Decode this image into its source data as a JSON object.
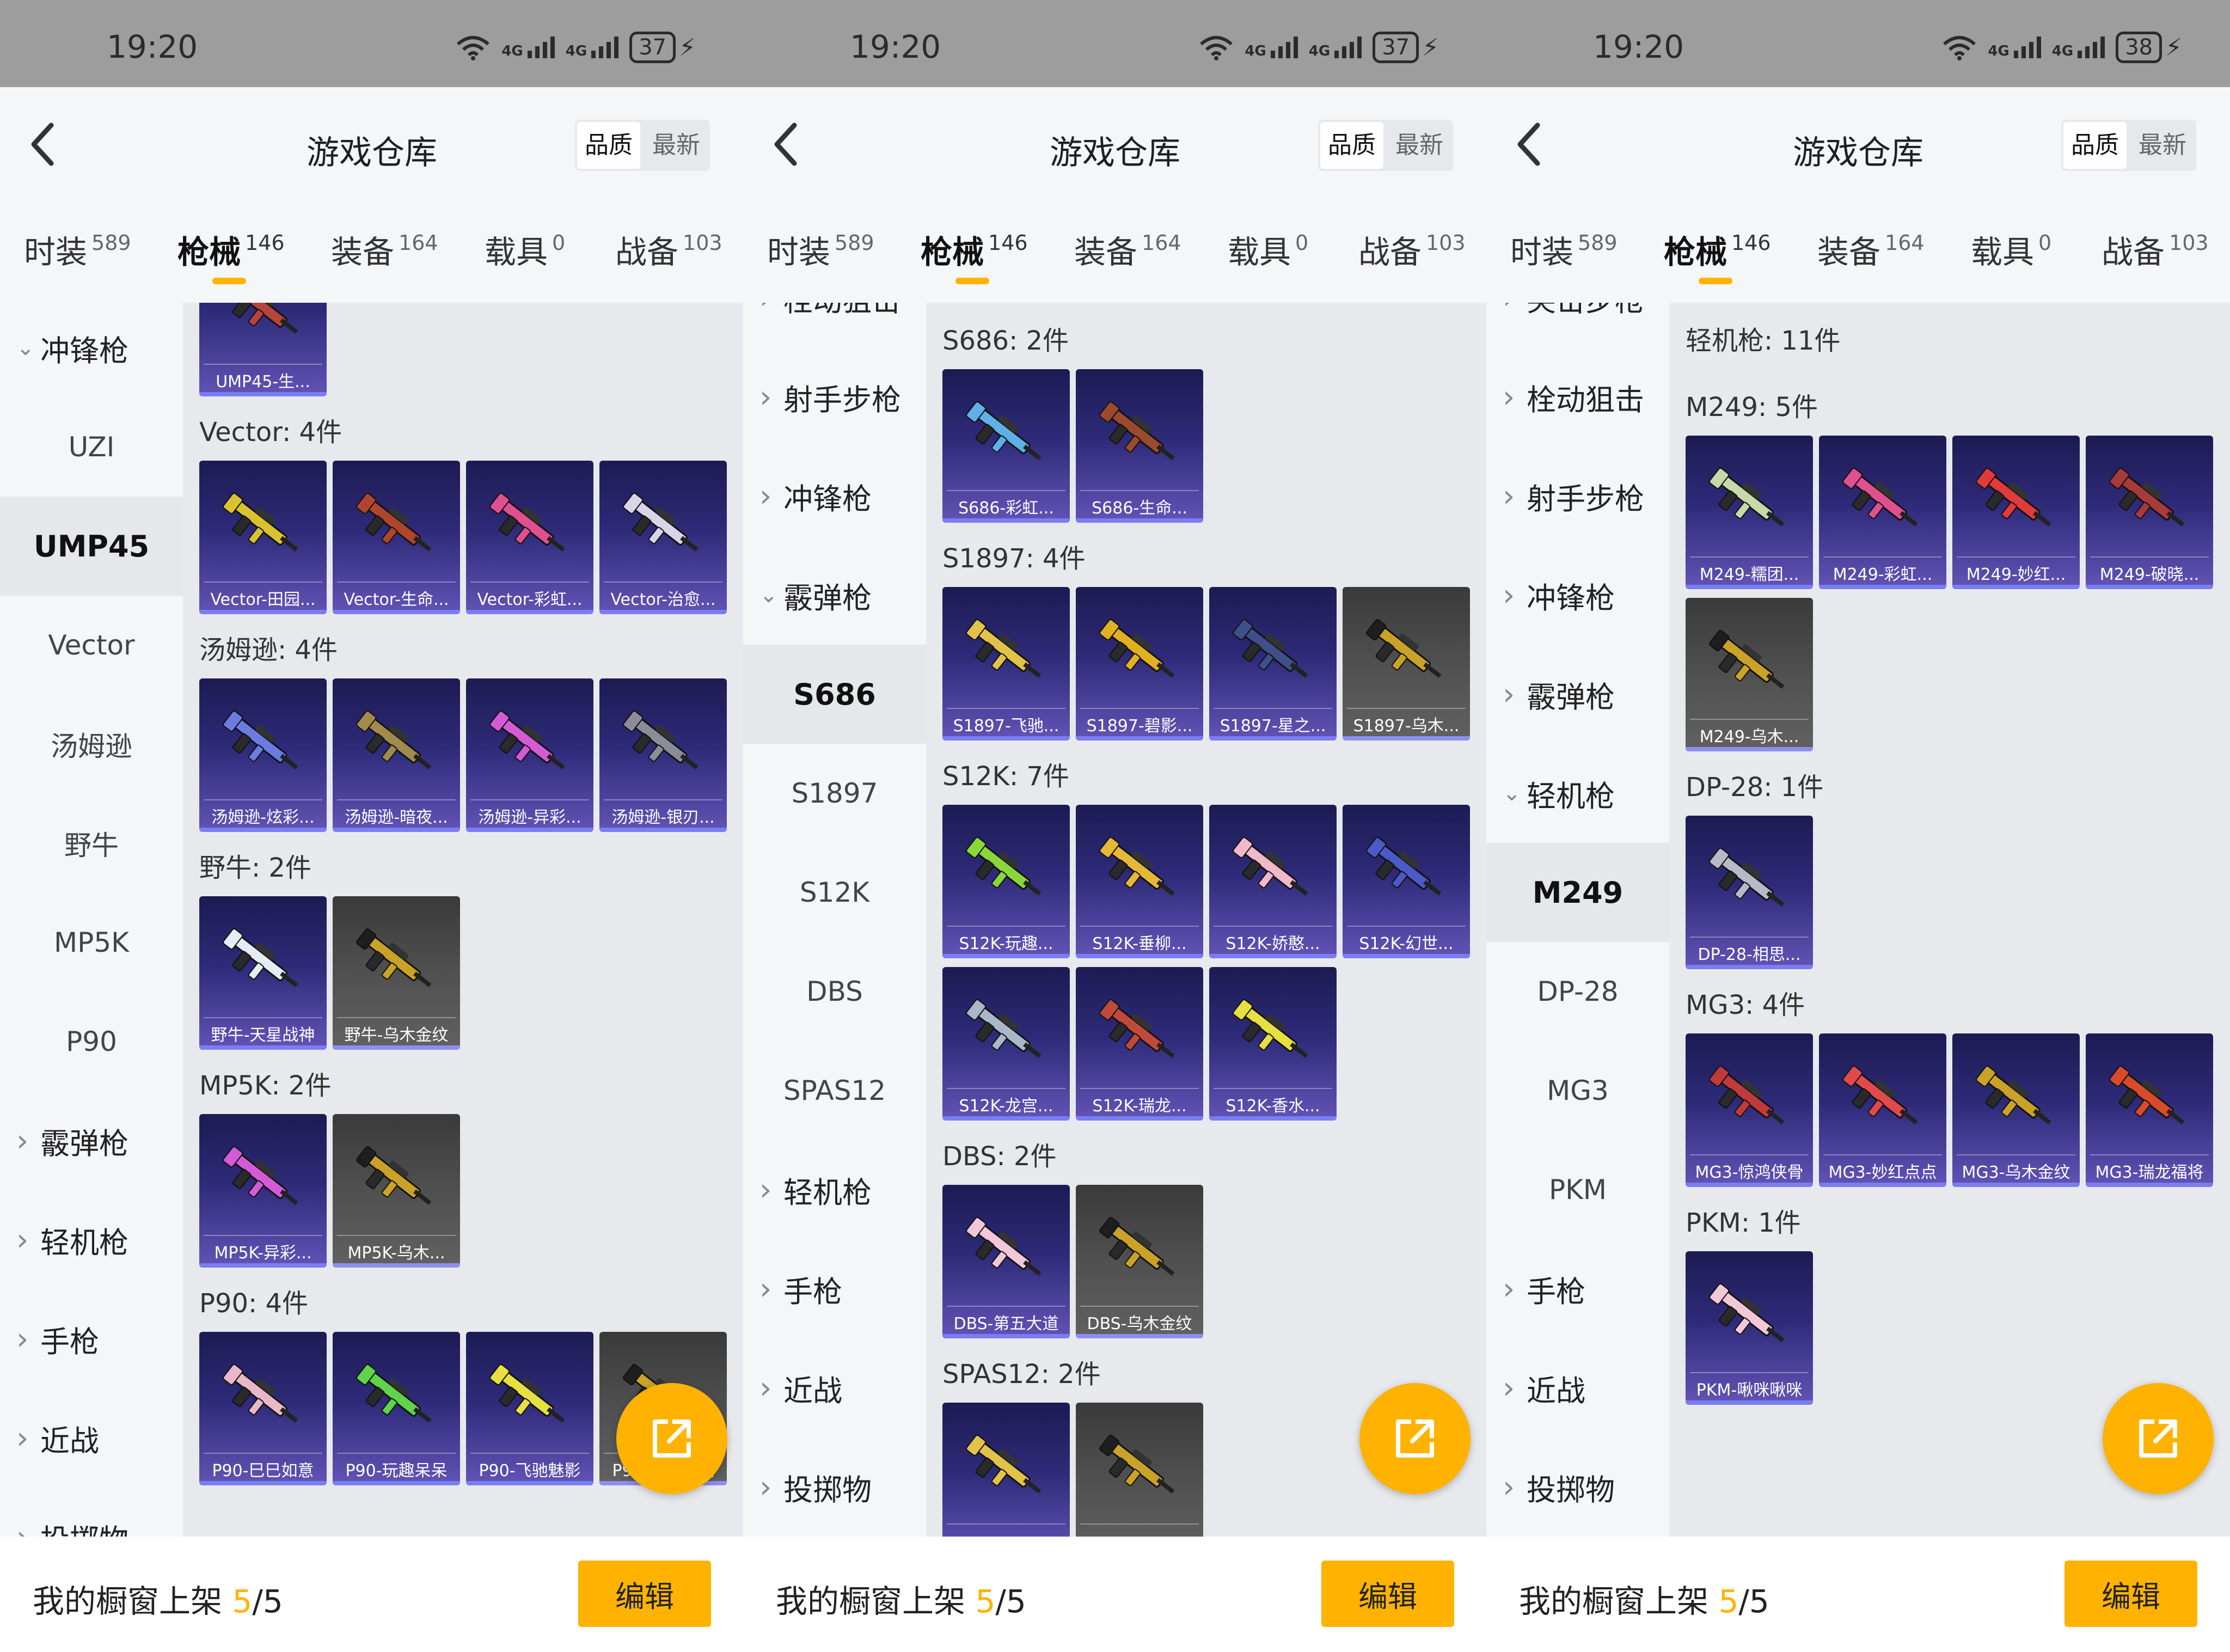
{
  "panels": [
    {
      "status": {
        "time": "19:20",
        "battery": "37"
      },
      "header": {
        "title": "游戏仓库",
        "sort_quality": "品质",
        "sort_newest": "最新"
      },
      "tabs": [
        {
          "label": "时装",
          "count": "589"
        },
        {
          "label": "枪械",
          "count": "146",
          "active": true
        },
        {
          "label": "装备",
          "count": "164"
        },
        {
          "label": "载具",
          "count": "0"
        },
        {
          "label": "战备",
          "count": "103"
        }
      ],
      "sidebar": [
        {
          "label": "冲锋枪",
          "kind": "cat",
          "expanded": true
        },
        {
          "label": "UZI",
          "kind": "sub"
        },
        {
          "label": "UMP45",
          "kind": "sub",
          "selected": true
        },
        {
          "label": "Vector",
          "kind": "sub"
        },
        {
          "label": "汤姆逊",
          "kind": "sub"
        },
        {
          "label": "野牛",
          "kind": "sub"
        },
        {
          "label": "MP5K",
          "kind": "sub"
        },
        {
          "label": "P90",
          "kind": "sub"
        },
        {
          "label": "霰弹枪",
          "kind": "cat"
        },
        {
          "label": "轻机枪",
          "kind": "cat"
        },
        {
          "label": "手枪",
          "kind": "cat"
        },
        {
          "label": "近战",
          "kind": "cat"
        },
        {
          "label": "投掷物",
          "kind": "cat"
        }
      ],
      "sections": [
        {
          "title": "",
          "items": [
            {
              "label": "UMP45-生...",
              "gold": false,
              "color": "#b5443a"
            }
          ]
        },
        {
          "title": "Vector: 4件",
          "items": [
            {
              "label": "Vector-田园...",
              "gold": false,
              "color": "#d8c22f"
            },
            {
              "label": "Vector-生命...",
              "gold": false,
              "color": "#b0452e"
            },
            {
              "label": "Vector-彩虹...",
              "gold": false,
              "color": "#e0508f"
            },
            {
              "label": "Vector-治愈...",
              "gold": false,
              "color": "#d9d4e8"
            }
          ]
        },
        {
          "title": "汤姆逊: 4件",
          "items": [
            {
              "label": "汤姆逊-炫彩...",
              "gold": false,
              "color": "#6a7ce0"
            },
            {
              "label": "汤姆逊-暗夜...",
              "gold": false,
              "color": "#a08a4c"
            },
            {
              "label": "汤姆逊-异彩...",
              "gold": false,
              "color": "#d45bd6"
            },
            {
              "label": "汤姆逊-银刃...",
              "gold": false,
              "color": "#8c8c99"
            }
          ]
        },
        {
          "title": "野牛: 2件",
          "items": [
            {
              "label": "野牛-天星战神",
              "gold": false,
              "color": "#e6ecf5"
            },
            {
              "label": "野牛-乌木金纹",
              "gold": true,
              "color": "#c9a227"
            }
          ]
        },
        {
          "title": "MP5K: 2件",
          "items": [
            {
              "label": "MP5K-异彩...",
              "gold": false,
              "color": "#d45bd6"
            },
            {
              "label": "MP5K-乌木...",
              "gold": true,
              "color": "#c9a227"
            }
          ]
        },
        {
          "title": "P90: 4件",
          "items": [
            {
              "label": "P90-巳巳如意",
              "gold": false,
              "color": "#e8b8c8"
            },
            {
              "label": "P90-玩趣呆呆",
              "gold": false,
              "color": "#5fd34a"
            },
            {
              "label": "P90-飞驰魅影",
              "gold": false,
              "color": "#e6e040"
            },
            {
              "label": "P90-乌木金纹",
              "gold": true,
              "color": "#c9a227"
            }
          ]
        }
      ],
      "bottom": {
        "text": "我的橱窗上架",
        "current": "5",
        "total": "/5",
        "edit": "编辑"
      }
    },
    {
      "status": {
        "time": "19:20",
        "battery": "37"
      },
      "header": {
        "title": "游戏仓库",
        "sort_quality": "品质",
        "sort_newest": "最新"
      },
      "tabs": [
        {
          "label": "时装",
          "count": "589"
        },
        {
          "label": "枪械",
          "count": "146",
          "active": true
        },
        {
          "label": "装备",
          "count": "164"
        },
        {
          "label": "载具",
          "count": "0"
        },
        {
          "label": "战备",
          "count": "103"
        }
      ],
      "sidebar": [
        {
          "label": "栓动狙击",
          "kind": "cat",
          "partial": true
        },
        {
          "label": "射手步枪",
          "kind": "cat"
        },
        {
          "label": "冲锋枪",
          "kind": "cat"
        },
        {
          "label": "霰弹枪",
          "kind": "cat",
          "expanded": true
        },
        {
          "label": "S686",
          "kind": "sub",
          "selected": true
        },
        {
          "label": "S1897",
          "kind": "sub"
        },
        {
          "label": "S12K",
          "kind": "sub"
        },
        {
          "label": "DBS",
          "kind": "sub"
        },
        {
          "label": "SPAS12",
          "kind": "sub"
        },
        {
          "label": "轻机枪",
          "kind": "cat"
        },
        {
          "label": "手枪",
          "kind": "cat"
        },
        {
          "label": "近战",
          "kind": "cat"
        },
        {
          "label": "投掷物",
          "kind": "cat"
        }
      ],
      "sections": [
        {
          "title": "S686: 2件",
          "items": [
            {
              "label": "S686-彩虹...",
              "gold": false,
              "color": "#5fb0e8"
            },
            {
              "label": "S686-生命...",
              "gold": false,
              "color": "#9a4a2e"
            }
          ]
        },
        {
          "title": "S1897: 4件",
          "items": [
            {
              "label": "S1897-飞驰...",
              "gold": false,
              "color": "#e3c24a"
            },
            {
              "label": "S1897-碧影...",
              "gold": false,
              "color": "#e0b020"
            },
            {
              "label": "S1897-星之...",
              "gold": false,
              "color": "#3e4f8a"
            },
            {
              "label": "S1897-乌木...",
              "gold": true,
              "color": "#c9a227"
            }
          ]
        },
        {
          "title": "S12K: 7件",
          "items": [
            {
              "label": "S12K-玩趣...",
              "gold": false,
              "color": "#8ad63a"
            },
            {
              "label": "S12K-垂柳...",
              "gold": false,
              "color": "#e6b838"
            },
            {
              "label": "S12K-娇憨...",
              "gold": false,
              "color": "#f0b8c8"
            },
            {
              "label": "S12K-幻世...",
              "gold": false,
              "color": "#4a5ac8"
            },
            {
              "label": "S12K-龙宫...",
              "gold": false,
              "color": "#a9b8c8"
            },
            {
              "label": "S12K-瑞龙...",
              "gold": false,
              "color": "#c04a3a"
            },
            {
              "label": "S12K-香水...",
              "gold": false,
              "color": "#e6e040"
            }
          ]
        },
        {
          "title": "DBS: 2件",
          "items": [
            {
              "label": "DBS-第五大道",
              "gold": false,
              "color": "#f2c8d8"
            },
            {
              "label": "DBS-乌木金纹",
              "gold": true,
              "color": "#c9a227"
            }
          ]
        },
        {
          "title": "SPAS12: 2件",
          "items": [
            {
              "label": "",
              "gold": false,
              "color": "#e3c24a"
            },
            {
              "label": "",
              "gold": true,
              "color": "#c9a227"
            }
          ]
        }
      ],
      "bottom": {
        "text": "我的橱窗上架",
        "current": "5",
        "total": "/5",
        "edit": "编辑"
      }
    },
    {
      "status": {
        "time": "19:20",
        "battery": "38"
      },
      "header": {
        "title": "游戏仓库",
        "sort_quality": "品质",
        "sort_newest": "最新"
      },
      "tabs": [
        {
          "label": "时装",
          "count": "589"
        },
        {
          "label": "枪械",
          "count": "146",
          "active": true
        },
        {
          "label": "装备",
          "count": "164"
        },
        {
          "label": "载具",
          "count": "0"
        },
        {
          "label": "战备",
          "count": "103"
        }
      ],
      "sidebar": [
        {
          "label": "突击步枪",
          "kind": "cat",
          "partial": true
        },
        {
          "label": "栓动狙击",
          "kind": "cat"
        },
        {
          "label": "射手步枪",
          "kind": "cat"
        },
        {
          "label": "冲锋枪",
          "kind": "cat"
        },
        {
          "label": "霰弹枪",
          "kind": "cat"
        },
        {
          "label": "轻机枪",
          "kind": "cat",
          "expanded": true
        },
        {
          "label": "M249",
          "kind": "sub",
          "selected": true
        },
        {
          "label": "DP-28",
          "kind": "sub"
        },
        {
          "label": "MG3",
          "kind": "sub"
        },
        {
          "label": "PKM",
          "kind": "sub"
        },
        {
          "label": "手枪",
          "kind": "cat"
        },
        {
          "label": "近战",
          "kind": "cat"
        },
        {
          "label": "投掷物",
          "kind": "cat"
        }
      ],
      "sections": [
        {
          "title": "轻机枪: 11件",
          "items": []
        },
        {
          "title": "M249: 5件",
          "items": [
            {
              "label": "M249-糯团...",
              "gold": false,
              "color": "#c8d8a8"
            },
            {
              "label": "M249-彩虹...",
              "gold": false,
              "color": "#e0508f"
            },
            {
              "label": "M249-妙红...",
              "gold": false,
              "color": "#e03a3a"
            },
            {
              "label": "M249-破晓...",
              "gold": false,
              "color": "#a83a3a"
            },
            {
              "label": "M249-乌木...",
              "gold": true,
              "color": "#c9a227"
            }
          ]
        },
        {
          "title": "DP-28: 1件",
          "items": [
            {
              "label": "DP-28-相思...",
              "gold": false,
              "color": "#b8b8c8"
            }
          ]
        },
        {
          "title": "MG3: 4件",
          "items": [
            {
              "label": "MG3-惊鸿侠骨",
              "gold": false,
              "color": "#c03a3a"
            },
            {
              "label": "MG3-妙红点点",
              "gold": false,
              "color": "#e04a4a"
            },
            {
              "label": "MG3-乌木金纹",
              "gold": false,
              "color": "#c9a227"
            },
            {
              "label": "MG3-瑞龙福将",
              "gold": false,
              "color": "#d84a2a"
            }
          ]
        },
        {
          "title": "PKM: 1件",
          "items": [
            {
              "label": "PKM-啾咪啾咪",
              "gold": false,
              "color": "#f2c8d8"
            }
          ]
        }
      ],
      "bottom": {
        "text": "我的橱窗上架",
        "current": "5",
        "total": "/5",
        "edit": "编辑"
      }
    }
  ]
}
